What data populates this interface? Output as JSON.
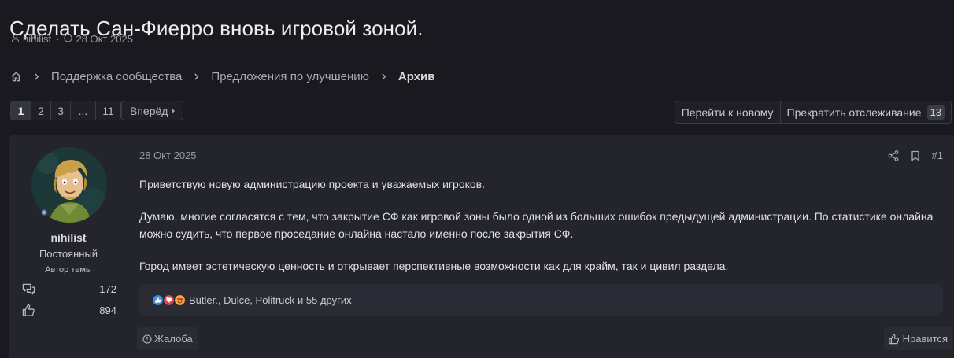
{
  "thread": {
    "title": "Сделать Сан-Фиерро вновь игровой зоной.",
    "author": "nihilist",
    "date": "28 Окт 2025",
    "meta_separator": "·"
  },
  "breadcrumb": {
    "home_icon": "home-icon",
    "items": [
      "Поддержка сообщества",
      "Предложения по улучшению"
    ],
    "current": "Архив"
  },
  "pagination": {
    "pages": [
      "1",
      "2",
      "3",
      "...",
      "11"
    ],
    "current_page": "1",
    "next_label": "Вперёд"
  },
  "thread_actions": {
    "go_new_label": "Перейти к новому",
    "unwatch_label": "Прекратить отслеживание",
    "watch_count": "13"
  },
  "post": {
    "username": "nihilist",
    "user_title": "Постоянный",
    "user_banner": "Автор темы",
    "messages_count": "172",
    "reactions_count": "894",
    "date": "28 Окт 2025",
    "number": "#1",
    "paragraphs": [
      "Приветствую новую администрацию проекта и уважаемых игроков.",
      "Думаю, многие согласятся с тем, что закрытие СФ как игровой зоны было одной из больших ошибок предыдущей администрации. По статистике онлайна можно судить, что первое проседание онлайна настало именно после закрытия СФ.",
      "Город имеет эстетическую ценность и открывает перспективные возможности как для крайм, так и цивил раздела."
    ],
    "reactions_text": "Butler., Dulce, Politruck и 55 других",
    "report_label": "Жалоба",
    "like_label": "Нравится"
  },
  "colors": {
    "background": "#19191f",
    "post_background": "#23242c",
    "reaction_like": "#3b8fe0",
    "reaction_dislike": "#e0454b",
    "reaction_love": "#f2a93b"
  }
}
